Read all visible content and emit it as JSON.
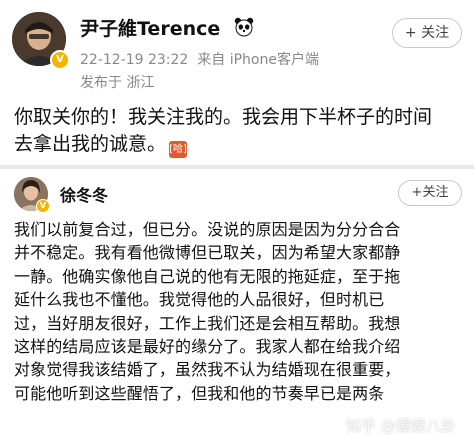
{
  "post1": {
    "author_name": "尹子維Terence",
    "timestamp": "22-12-19 23:22",
    "source": "来自 iPhone客户端",
    "location": "发布于 浙江",
    "follow_label": "+ 关注",
    "content_lines": [
      "你取关你的！我关注我的。我会用下半杯子的时间",
      "去拿出我的诚意。"
    ],
    "emoji_label": "[哈]"
  },
  "post2": {
    "author_name": "徐冬冬",
    "follow_label": "+关注",
    "content_lines": [
      "我们以前复合过，但已分。没说的原因是因为分分合合",
      "并不稳定。我有看他微博但已取关，因为希望大家都静",
      "一静。他确实像他自己说的他有无限的拖延症，至于拖",
      "延什么我也不懂他。我觉得他的人品很好，但时机已",
      "过，当好朋友很好，工作上我们还是会相互帮助。我想",
      "这样的结局应该是最好的缘分了。我家人都在给我介绍",
      "对象觉得我该结婚了，虽然我不认为结婚现在很重要，",
      "可能他听到这些醒悟了，但我和他的节奏早已是两条"
    ]
  },
  "watermark": "知乎 @爆娱八卦",
  "colors": {
    "badge": "#f5b400",
    "meta_text": "#888888",
    "divider": "#e9e9e9"
  },
  "icons": [
    "avatar",
    "verified-badge-icon",
    "panda-icon"
  ]
}
